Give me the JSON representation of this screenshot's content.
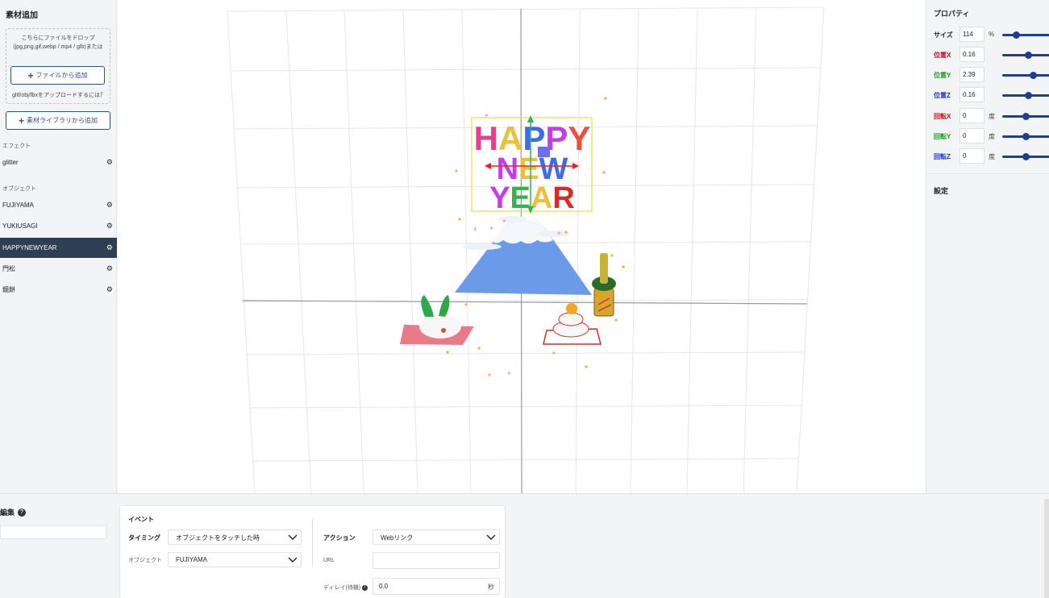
{
  "sidebar": {
    "title": "素材追加",
    "drop_text": "こちらにファイルをドロップ (jpg,png,gif,webp / mp4 / glb)または",
    "file_button": "ファイルから追加",
    "gltf_note": "gltf/obj/fbxをアップロードするには？",
    "library_button": "素材ライブラリから追加",
    "effects_label": "エフェクト",
    "effects": [
      {
        "label": "glitter"
      }
    ],
    "objects_label": "オブジェクト",
    "objects": [
      {
        "label": "FUJIYAMA",
        "active": false
      },
      {
        "label": "YUKIUSAGI",
        "active": false
      },
      {
        "label": "HAPPYNEWYEAR",
        "active": true
      },
      {
        "label": "門松",
        "active": false
      },
      {
        "label": "鏡餅",
        "active": false
      }
    ]
  },
  "properties": {
    "title": "プロパティ",
    "items": [
      {
        "label": "サイズ",
        "value": "114",
        "unit": "%",
        "color": "#222222",
        "slider": 0.3
      },
      {
        "label": "位置X",
        "value": "0.16",
        "unit": "",
        "color": "#d0021b",
        "slider": 0.55
      },
      {
        "label": "位置Y",
        "value": "2.39",
        "unit": "",
        "color": "#1a9c1a",
        "slider": 0.65
      },
      {
        "label": "位置Z",
        "value": "0.16",
        "unit": "",
        "color": "#1a2fd0",
        "slider": 0.55
      },
      {
        "label": "回転X",
        "value": "0",
        "unit": "度",
        "color": "#d0021b",
        "slider": 0.5
      },
      {
        "label": "回転Y",
        "value": "0",
        "unit": "度",
        "color": "#1a9c1a",
        "slider": 0.5
      },
      {
        "label": "回転Z",
        "value": "0",
        "unit": "度",
        "color": "#1a2fd0",
        "slider": 0.5
      }
    ],
    "settings_label": "設定"
  },
  "scene": {
    "sign_rows": [
      "HAPPY",
      "NEW",
      "YEAR"
    ]
  },
  "bottom": {
    "edit_title": "編集",
    "event_title": "イベント",
    "timing_label": "タイミング",
    "timing_value": "オブジェクトをタッチした時",
    "object_label": "オブジェクト",
    "object_value": "FUJIYAMA",
    "action_label": "アクション",
    "action_value": "Webリンク",
    "url_label": "URL",
    "url_value": "",
    "delay_label": "ディレイ(待機)",
    "delay_value": "0.0",
    "delay_unit": "秒"
  },
  "colors": {
    "accent": "#2f4e8a",
    "active_bg": "#2d3e55",
    "slider": "#1e3f8f"
  }
}
